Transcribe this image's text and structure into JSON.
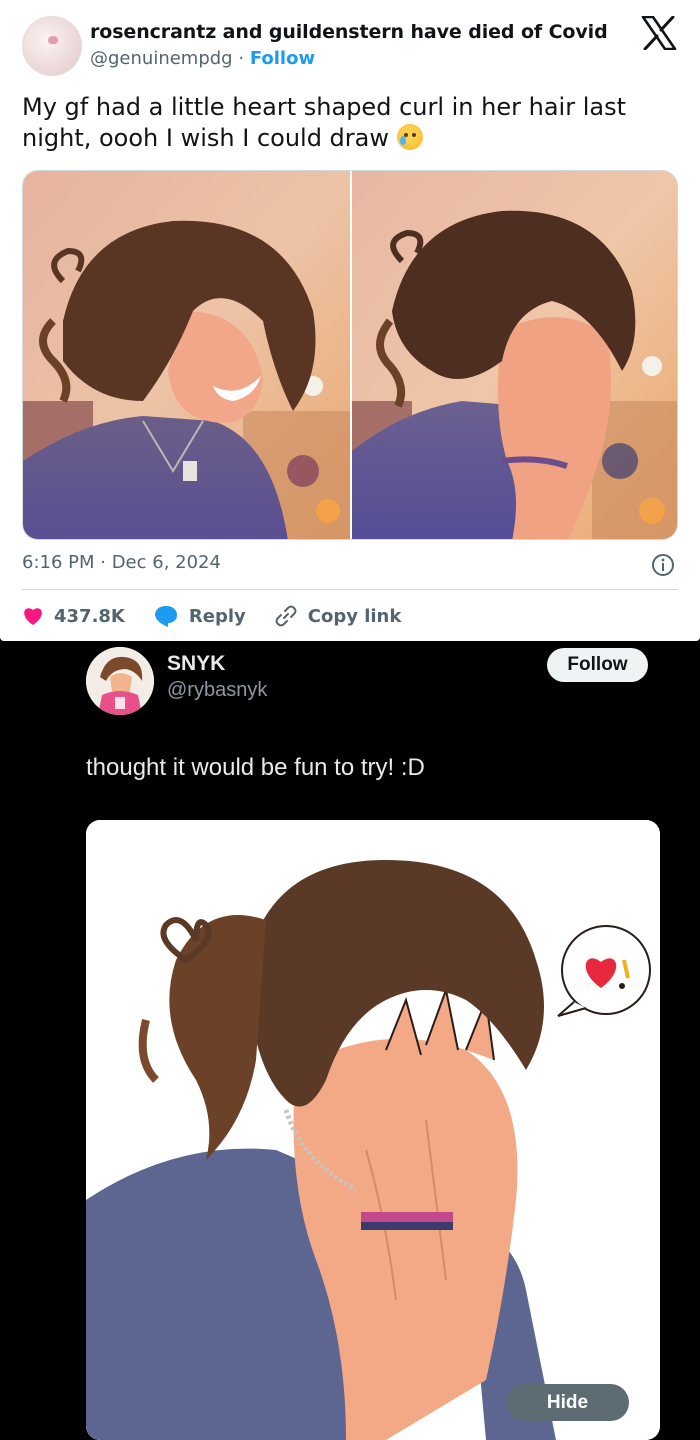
{
  "tweet1": {
    "author_name": "rosencrantz and guildenstern have died of Covid",
    "handle": "@genuinempdg",
    "separator": "·",
    "follow_label": "Follow",
    "text": "My gf had a little heart shaped curl in her hair last night, oooh I wish I could draw",
    "emoji": "crying-face-emoji",
    "timestamp": "6:16 PM · Dec 6, 2024",
    "likes": "437.8K",
    "reply_label": "Reply",
    "copy_link_label": "Copy link",
    "colors": {
      "like": "#f91880",
      "reply": "#1d9bf0",
      "follow": "#1d9bf0"
    }
  },
  "tweet2": {
    "author_name": "SNYK",
    "handle": "@rybasnyk",
    "follow_label": "Follow",
    "text": "thought it would be fun to try! :D",
    "hide_label": "Hide"
  }
}
